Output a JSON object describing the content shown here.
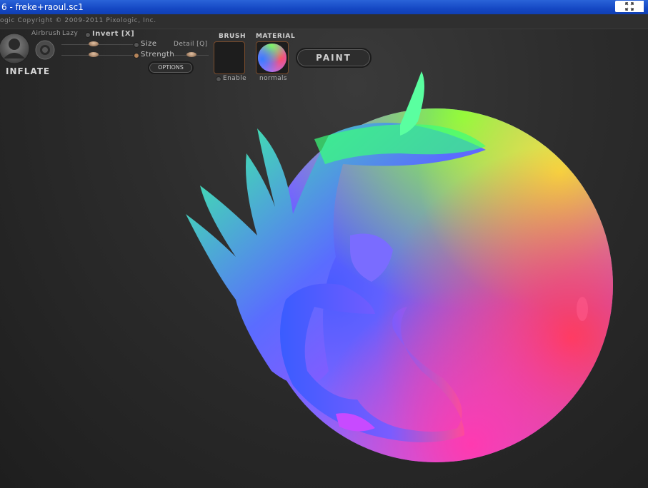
{
  "window": {
    "title": "6 - freke+raoul.sc1"
  },
  "header": {
    "copyright": "ogic   Copyright © 2009-2011 Pixologic, Inc."
  },
  "brush": {
    "name": "INFLATE",
    "airbrush_label": "Airbrush",
    "lazy_label": "Lazy",
    "invert_label": "Invert [X]",
    "size_label": "Size",
    "strength_label": "Strength",
    "detail_label": "Detail [Q]",
    "options_label": "OPTIONS"
  },
  "panels": {
    "brush_label": "BRUSH",
    "enable_label": "Enable",
    "material_label": "MATERIAL",
    "material_name": "normals",
    "paint_label": "PAINT"
  },
  "colors": {
    "titlebar": "#1548c4",
    "background": "#262626",
    "accent_border": "#7a4c2c"
  }
}
